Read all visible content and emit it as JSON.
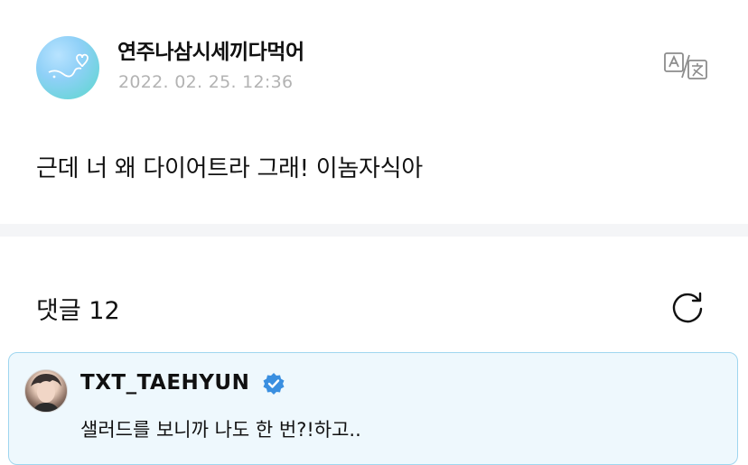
{
  "post": {
    "author": "연주나삼시세끼다먹어",
    "date": "2022. 02. 25. 12:36",
    "body": "근데 너 왜 다이어트라 그래! 이놈자식아",
    "translate_icon": "translate-icon"
  },
  "comments": {
    "label": "댓글",
    "count": "12",
    "refresh_icon": "refresh-icon",
    "items": [
      {
        "name": "TXT_TAEHYUN",
        "verified_icon": "verified-badge-icon",
        "text": "샐러드를 보니까 나도 한 번?!하고.."
      }
    ]
  },
  "colors": {
    "date_gray": "#b3b3b3",
    "divider": "#f4f5f7",
    "highlight_bg": "#eef8fd",
    "highlight_border": "#9fd6ef",
    "verified_blue": "#3a8fe0"
  }
}
